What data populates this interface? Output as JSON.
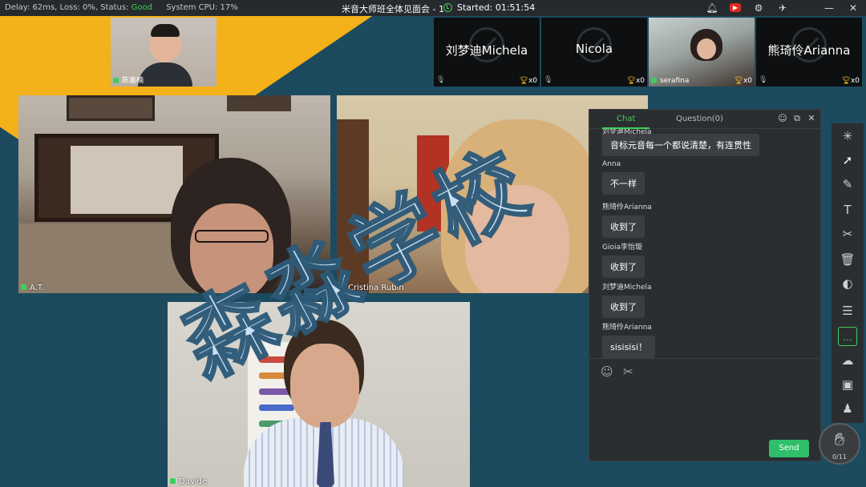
{
  "topbar": {
    "stats": "Delay: 62ms, Loss: 0%, Status:",
    "status_value": "Good",
    "cpu": "System CPU: 17%",
    "title": "米音大师班全体见面会 - 1",
    "timer": "Started: 01:51:54",
    "icons": [
      "bell-icon",
      "youtube-icon",
      "settings-icon",
      "pin-icon",
      "minimize-icon",
      "close-icon"
    ]
  },
  "self_thumb": {
    "name": "陈嘉楠"
  },
  "thumbnails": [
    {
      "name": "刘梦迪Michela",
      "trophy": "x0",
      "camera": "off"
    },
    {
      "name": "Nicola",
      "trophy": "x0",
      "camera": "off"
    },
    {
      "name": "serafina",
      "trophy": "x0",
      "camera": "on"
    },
    {
      "name": "熊琦伶Arianna",
      "trophy": "x0",
      "camera": "off"
    }
  ],
  "tiles": [
    {
      "name": "A.T."
    },
    {
      "name": "Cristina Rubin"
    },
    {
      "name": "Davide"
    }
  ],
  "watermark": "森淼学校",
  "chat": {
    "tabs": [
      "Chat",
      "Question(0)"
    ],
    "partial_top": "刘梦迪Michela",
    "messages": [
      {
        "sender": "",
        "text": "音标元音每一个都说清楚，有连贯性"
      },
      {
        "sender": "Anna",
        "text": "不一样"
      },
      {
        "sender": "熊琦伶Arianna",
        "text": "收到了"
      },
      {
        "sender": "Gioia李怡璇",
        "text": "收到了"
      },
      {
        "sender": "刘梦迪Michela",
        "text": "收到了"
      },
      {
        "sender": "熊琦伶Arianna",
        "text": "sisisisi！"
      }
    ],
    "send_label": "Send"
  },
  "raise_hand": {
    "count": "0/11"
  },
  "colors": {
    "accent": "#3ecf5a",
    "background": "#1c4a5e",
    "yellow": "#f3b11a",
    "send": "#2fbf6a"
  }
}
